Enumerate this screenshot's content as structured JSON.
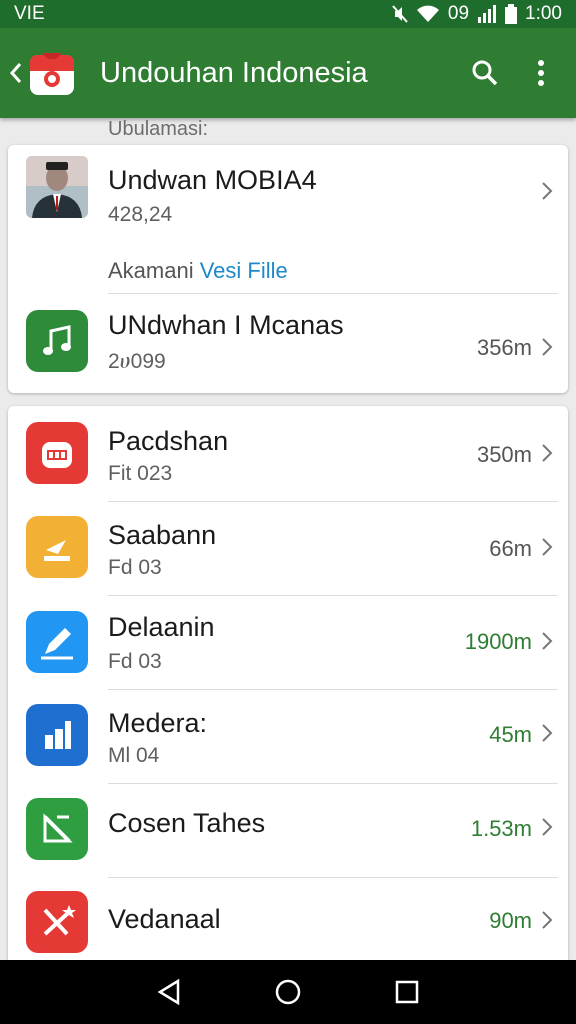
{
  "status_bar": {
    "carrier": "VIE",
    "time": "1:00",
    "signal_text": "09"
  },
  "app_bar": {
    "title": "Undouhan Indonesia"
  },
  "section_label": "Ubulamasi:",
  "featured": {
    "app": {
      "title": "Undwan MOBIA4",
      "subtitle": "428,24",
      "icon": "profile-photo"
    },
    "link_row": {
      "prefix": "Akamani",
      "link": "Vesi Fille"
    },
    "item": {
      "title": "UNdwhan I Mcanas",
      "subtitle": "2ሀ099",
      "size": "356m",
      "icon": "music-note-icon",
      "color": "#2e8b3a"
    }
  },
  "list": [
    {
      "title": "Pacdshan",
      "subtitle": "Fit 023",
      "size": "350m",
      "size_color": "#555555",
      "icon": "calendar-icon",
      "color": "#e53935"
    },
    {
      "title": "Saabann",
      "subtitle": "Fd 03",
      "size": "66m",
      "size_color": "#555555",
      "icon": "download-icon",
      "color": "#f2b134"
    },
    {
      "title": "Delaanin",
      "subtitle": "Fd 03",
      "size": "1900m",
      "size_color": "#2e7d32",
      "icon": "pencil-icon",
      "color": "#2196f3"
    },
    {
      "title": "Medera:",
      "subtitle": "Ml 04",
      "size": "45m",
      "size_color": "#2e7d32",
      "icon": "chart-icon",
      "color": "#1e6fd0"
    },
    {
      "title": "Cosen Tahes",
      "subtitle": "",
      "size": "1.53m",
      "size_color": "#2e7d32",
      "icon": "slash-icon",
      "color": "#2e9e40"
    },
    {
      "title": "Vedanaal",
      "subtitle": "",
      "size": "90m",
      "size_color": "#2e7d32",
      "icon": "cross-star-icon",
      "color": "#e53935"
    }
  ],
  "colors": {
    "primary": "#2e7d32",
    "status": "#1f6d2d",
    "link": "#1e88c9"
  }
}
